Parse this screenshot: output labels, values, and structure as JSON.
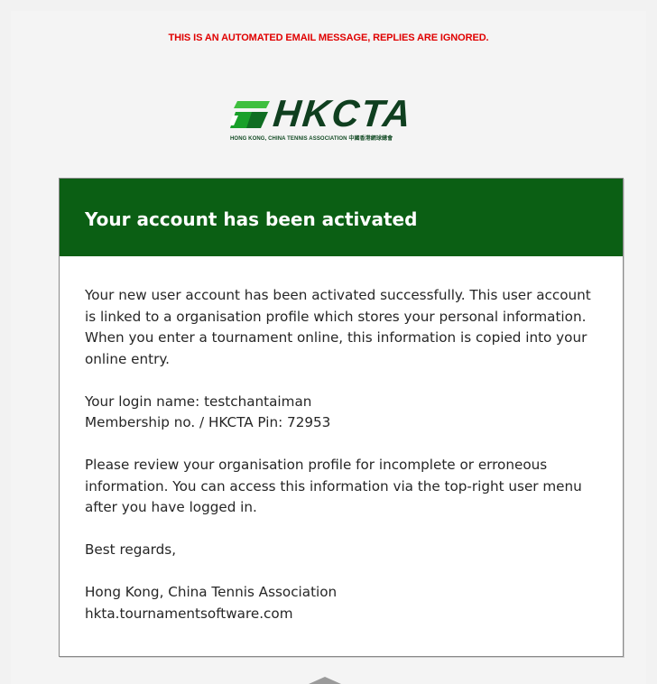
{
  "notice": "THIS IS AN AUTOMATED EMAIL MESSAGE, REPLIES ARE IGNORED.",
  "logo": {
    "text": "HKCTA",
    "subtitle": "HONG KONG, CHINA TENNIS ASSOCIATION 中國香港網球總會",
    "colors": {
      "primary": "#0f3f1f",
      "accent": "#3fbf3f"
    }
  },
  "card": {
    "title": "Your account has been activated",
    "header_color": "#0b5f14",
    "paragraph1": "Your new user account has been activated successfully. This user account is linked to a organisation profile which stores your personal information. When you enter a tournament online, this information is copied into your online entry.",
    "login_line": "Your login name: testchantaiman",
    "membership_line": "Membership no. / HKCTA Pin: 72953",
    "paragraph3": "Please review your organisation profile for incomplete or erroneous information. You can access this information via the top-right user menu after you have logged in.",
    "regards": "Best regards,",
    "org_name": "Hong Kong, China Tennis Association",
    "org_site": "hkta.tournamentsoftware.com"
  }
}
